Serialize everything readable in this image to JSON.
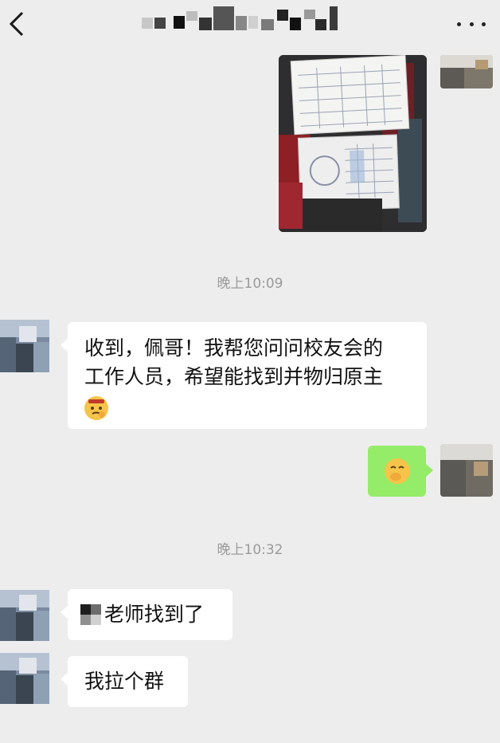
{
  "header": {
    "back_icon": "chevron-left-icon",
    "title_redacted": true,
    "more_icon": "ellipsis-icon"
  },
  "messages": [
    {
      "side": "right",
      "kind": "image",
      "description_icon": "photo-thumbnail"
    },
    {
      "kind": "time",
      "text": "晚上10:09"
    },
    {
      "side": "left",
      "kind": "text",
      "lines": [
        "收到，佩哥！我帮您问问校友会的",
        "工作人员，希望能找到并物归原主"
      ],
      "emoji": "salute-face-emoji"
    },
    {
      "side": "right",
      "kind": "emoji",
      "emoji": "giggle-face-emoji"
    },
    {
      "kind": "time",
      "text": "晚上10:32"
    },
    {
      "side": "left",
      "kind": "text",
      "text": "老师找到了",
      "prefix_redacted": true
    },
    {
      "side": "left",
      "kind": "text",
      "text": "我拉个群"
    }
  ],
  "colors": {
    "background": "#ededed",
    "bubble_white": "#ffffff",
    "bubble_green": "#95ec69",
    "time_text": "#9b9b9b"
  }
}
